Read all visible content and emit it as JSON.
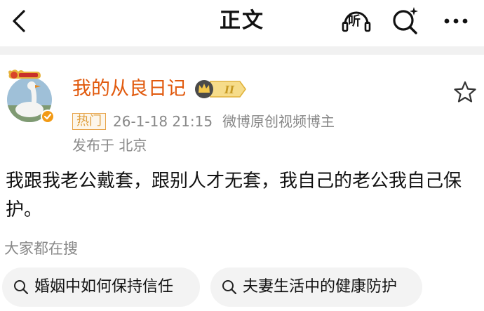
{
  "header": {
    "title": "正文",
    "listen_label": "听"
  },
  "post": {
    "author": "我的从良日记",
    "badge_level": "II",
    "hot_tag": "热门",
    "timestamp": "26-1-18 21:15",
    "source": "微博原创视频博主",
    "location": "发布于 北京",
    "text": "我跟我老公戴套，跟别人才无套，我自己的老公我自己保护。"
  },
  "related": {
    "label": "大家都在搜",
    "items": [
      {
        "label": "婚姻中如何保持信任"
      },
      {
        "label": "夫妻生活中的健康防护"
      }
    ]
  },
  "colors": {
    "nickname": "#e15a0e",
    "hot_border": "#e8a44a",
    "chip_bg": "#f3f3f3",
    "separator": "#f1f1f1"
  },
  "icons": [
    "back-icon",
    "listen-icon",
    "search-icon",
    "more-icon",
    "favorite-star-icon",
    "verified-icon",
    "search-icon"
  ]
}
